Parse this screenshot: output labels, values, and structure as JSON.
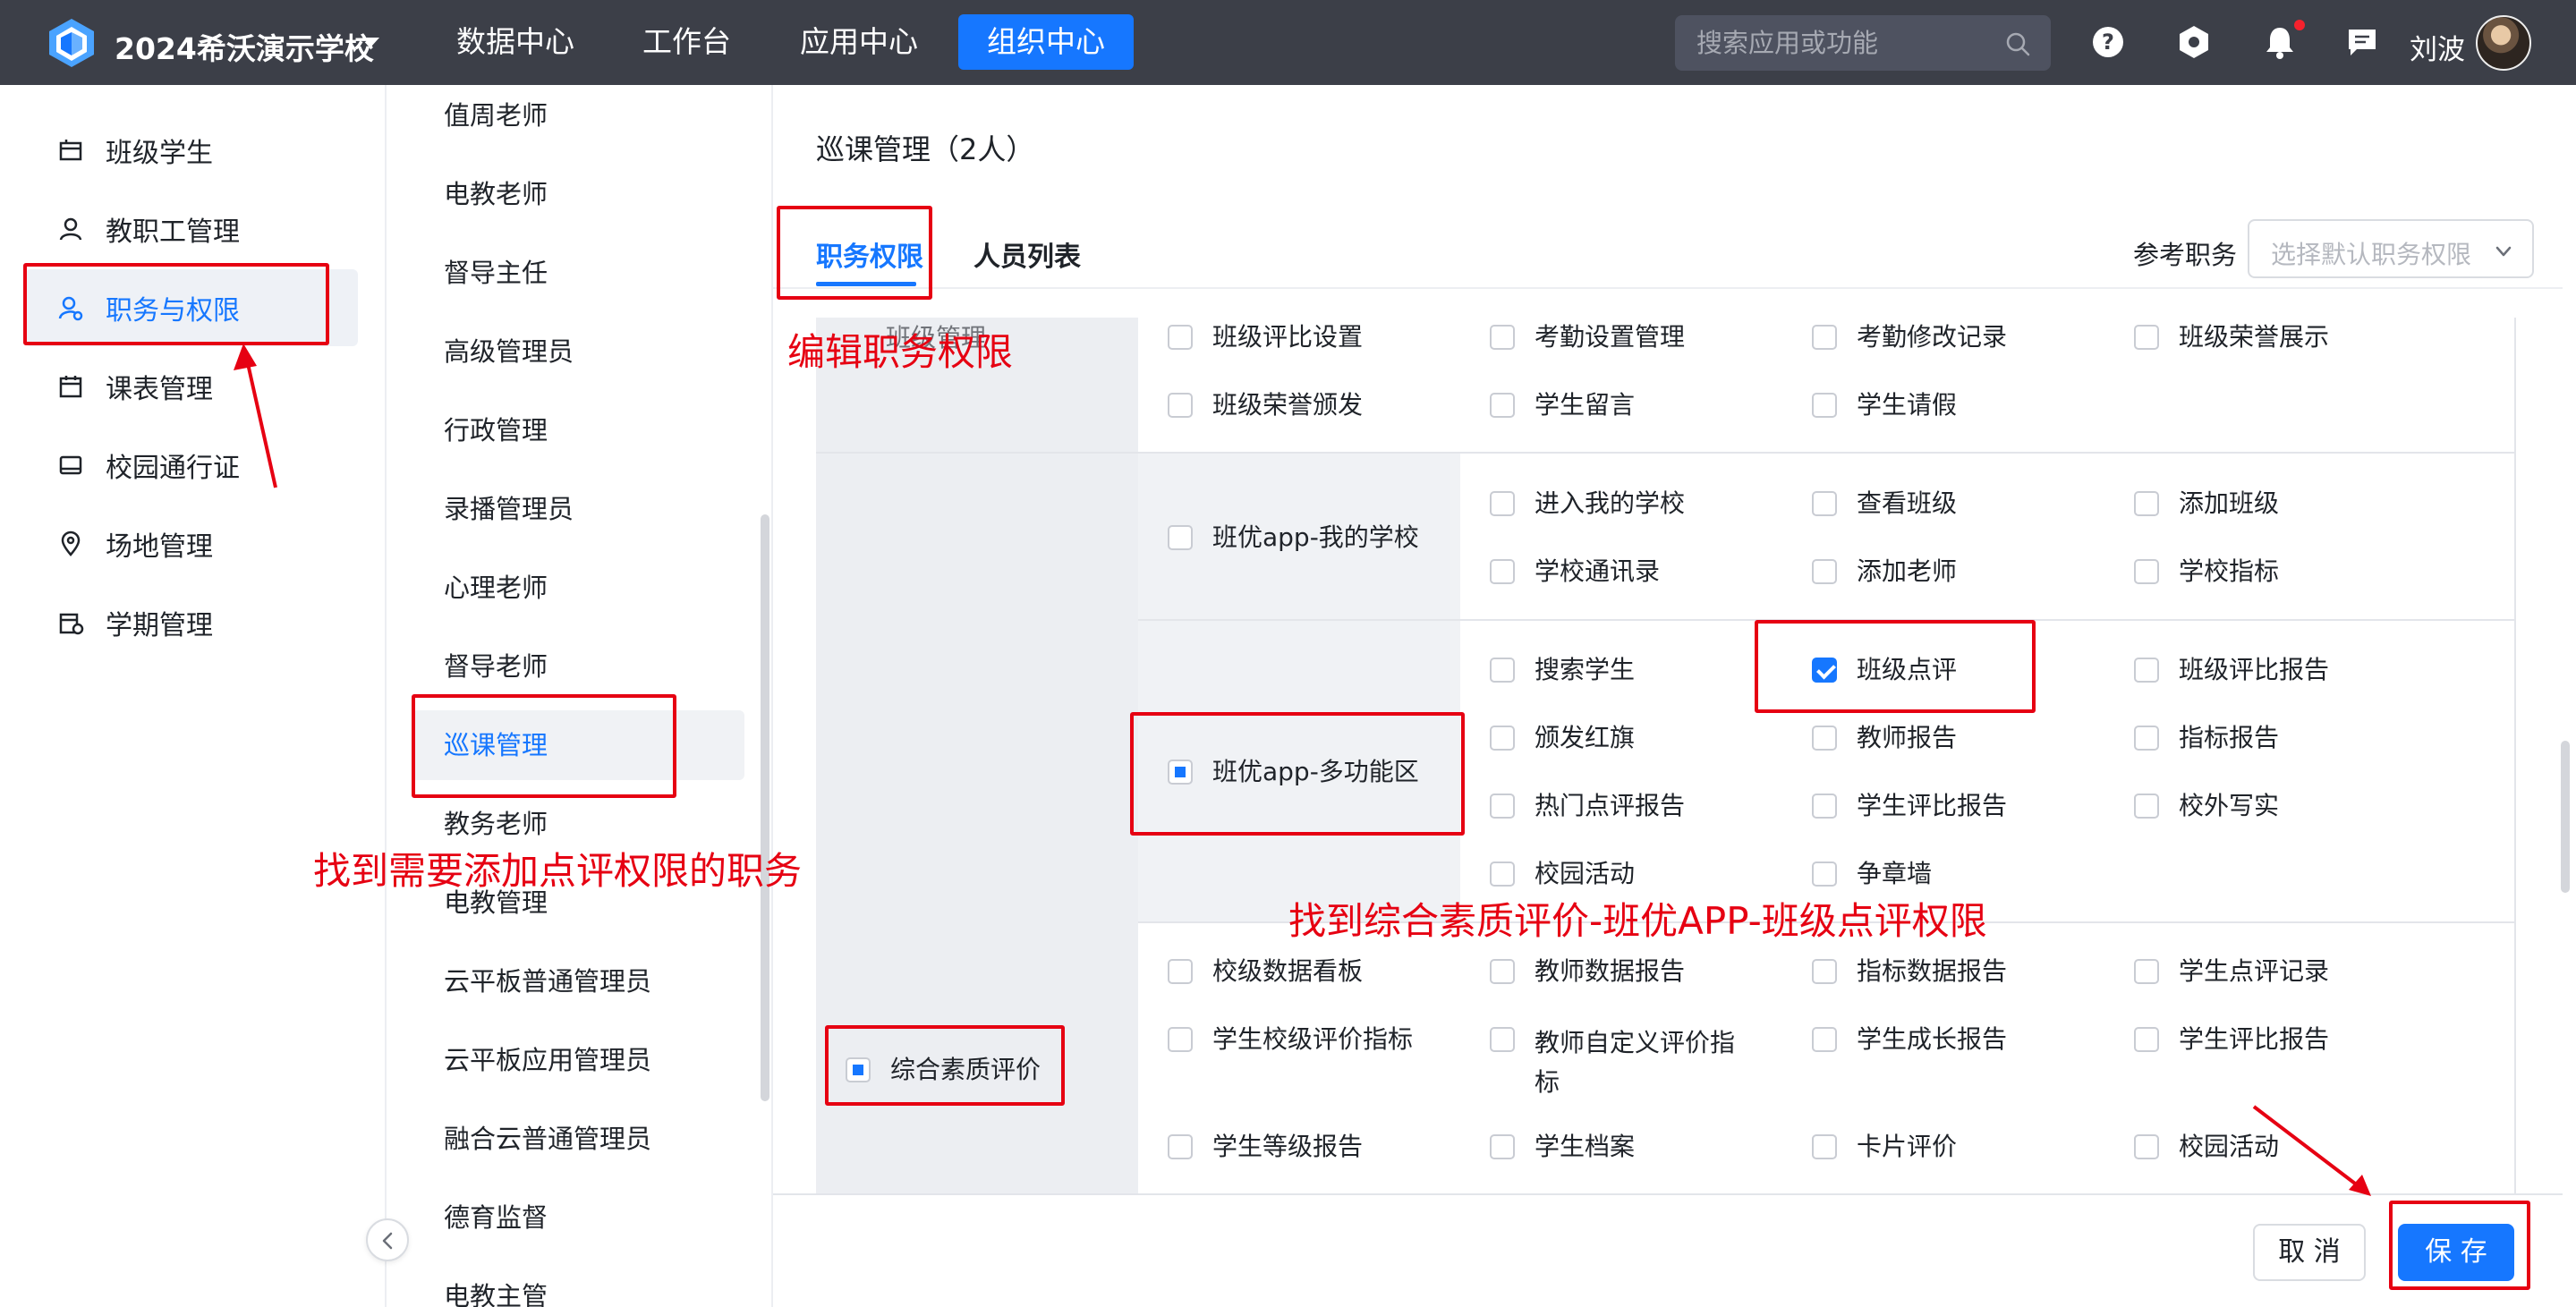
{
  "topbar": {
    "school_name": "2024希沃演示学校",
    "nav": [
      "数据中心",
      "工作台",
      "应用中心",
      "组织中心"
    ],
    "active_nav": "组织中心",
    "search_placeholder": "搜索应用或功能",
    "user_name": "刘波",
    "icons": [
      "help-icon",
      "settings-hex-icon",
      "bell-icon",
      "message-icon"
    ]
  },
  "left_menu": {
    "items": [
      {
        "label": "班级学生",
        "icon": "class-icon"
      },
      {
        "label": "教职工管理",
        "icon": "person-icon"
      },
      {
        "label": "职务与权限",
        "icon": "role-permission-icon"
      },
      {
        "label": "课表管理",
        "icon": "calendar-icon"
      },
      {
        "label": "校园通行证",
        "icon": "card-icon"
      },
      {
        "label": "场地管理",
        "icon": "location-icon"
      },
      {
        "label": "学期管理",
        "icon": "term-calendar-icon"
      }
    ],
    "active": "职务与权限"
  },
  "roles": {
    "items": [
      "值周老师",
      "电教老师",
      "督导主任",
      "高级管理员",
      "行政管理",
      "录播管理员",
      "心理老师",
      "督导老师",
      "巡课管理",
      "教务老师",
      "电教管理",
      "云平板普通管理员",
      "云平板应用管理员",
      "融合云普通管理员",
      "德育监督",
      "电教主管"
    ],
    "active": "巡课管理"
  },
  "main": {
    "title": "巡课管理（2人）",
    "tabs": [
      "职务权限",
      "人员列表"
    ],
    "active_tab": "职务权限",
    "ref_label": "参考职务",
    "ref_placeholder": "选择默认职务权限",
    "partial_group_label": "班级管理",
    "perm_row0": [
      "班级评比设置",
      "考勤设置管理",
      "考勤修改记录",
      "班级荣誉展示",
      "班级荣誉颁发",
      "学生留言",
      "学生请假"
    ],
    "group_mine": {
      "label": "班优app-我的学校",
      "items": [
        "进入我的学校",
        "查看班级",
        "添加班级",
        "学校通讯录",
        "添加老师",
        "学校指标"
      ]
    },
    "group_multi": {
      "label": "班优app-多功能区",
      "items": [
        "搜索学生",
        "班级点评",
        "班级评比报告",
        "颁发红旗",
        "教师报告",
        "指标报告",
        "热门点评报告",
        "学生评比报告",
        "校外写实",
        "校园活动",
        "争章墙"
      ],
      "checked": "班级点评"
    },
    "group_quality": {
      "label": "综合素质评价",
      "items": [
        "校级数据看板",
        "教师数据报告",
        "指标数据报告",
        "学生点评记录",
        "学生校级评价指标",
        "教师自定义评价指标",
        "学生成长报告",
        "学生评比报告",
        "学生等级报告",
        "学生档案",
        "卡片评价",
        "校园活动"
      ]
    },
    "cancel_label": "取 消",
    "save_label": "保 存"
  },
  "annotations": {
    "edit_permission": "编辑职务权限",
    "find_role": "找到需要添加点评权限的职务",
    "find_permission": "找到综合素质评价-班优APP-班级点评权限",
    "color": "#e60012"
  },
  "colors": {
    "topbar": "#3c3f48",
    "accent": "#1677ff",
    "annotation": "#e60012"
  }
}
